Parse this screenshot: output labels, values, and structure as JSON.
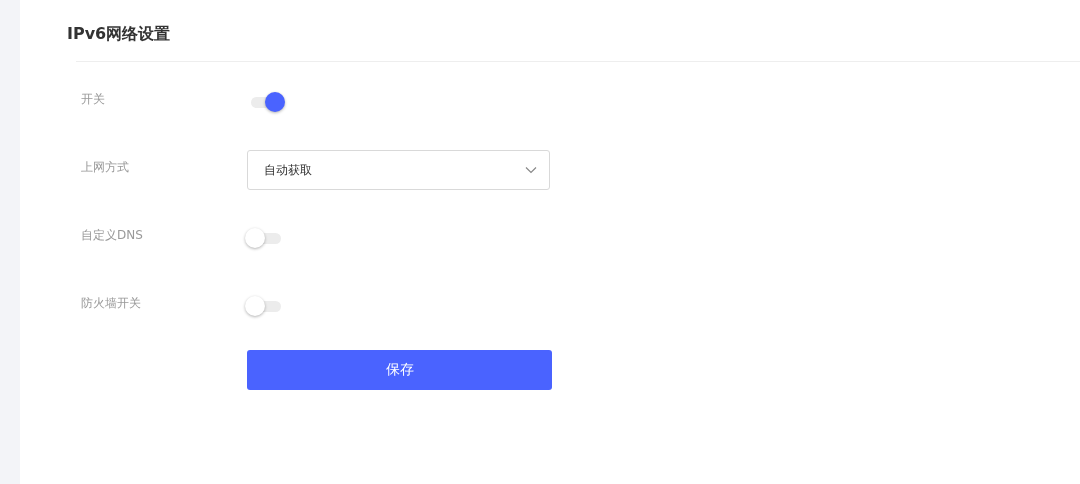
{
  "title": "IPv6网络设置",
  "fields": [
    {
      "kind": "toggle",
      "label": "开关",
      "on": true
    },
    {
      "kind": "select",
      "label": "上网方式",
      "value": "自动获取"
    },
    {
      "kind": "toggle",
      "label": "自定义DNS",
      "on": false
    },
    {
      "kind": "toggle",
      "label": "防火墙开关",
      "on": false
    }
  ],
  "save_button": "保存"
}
